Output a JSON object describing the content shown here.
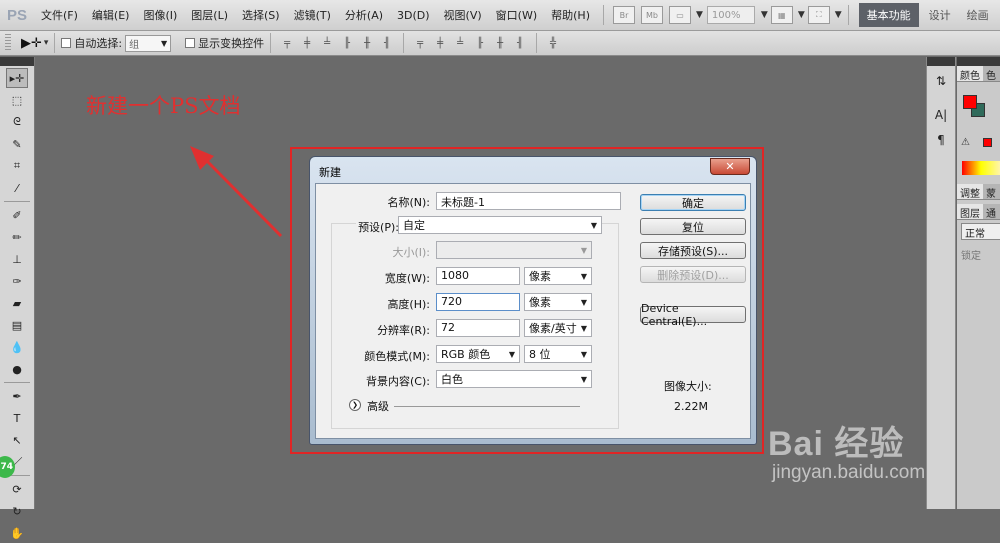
{
  "app": {
    "logo": "PS"
  },
  "menu": [
    "文件(F)",
    "编辑(E)",
    "图像(I)",
    "图层(L)",
    "选择(S)",
    "滤镜(T)",
    "分析(A)",
    "3D(D)",
    "视图(V)",
    "窗口(W)",
    "帮助(H)"
  ],
  "menubar": {
    "br_label": "Br",
    "mb_label": "Mb",
    "zoom": "100%",
    "workspaces": {
      "active": "基本功能",
      "design": "设计",
      "paint": "绘画"
    }
  },
  "options": {
    "auto_select_label": "自动选择:",
    "auto_select_target": "组",
    "show_transform_label": "显示变换控件"
  },
  "annotation": {
    "text": "新建一个PS文档",
    "color": "#e03030"
  },
  "dialog": {
    "title": "新建",
    "close_label": "✕",
    "name_label": "名称(N):",
    "name_value": "未标题-1",
    "preset_label": "预设(P):",
    "preset_value": "自定",
    "size_label": "大小(I):",
    "width_label": "宽度(W):",
    "width_value": "1080",
    "width_unit": "像素",
    "height_label": "高度(H):",
    "height_value": "720",
    "height_unit": "像素",
    "resolution_label": "分辨率(R):",
    "resolution_value": "72",
    "resolution_unit": "像素/英寸",
    "color_mode_label": "颜色模式(M):",
    "color_mode_value": "RGB 颜色",
    "bit_depth": "8 位",
    "bg_label": "背景内容(C):",
    "bg_value": "白色",
    "advanced_label": "高级",
    "buttons": {
      "ok": "确定",
      "reset": "复位",
      "save_preset": "存储预设(S)...",
      "delete_preset": "删除预设(D)...",
      "device_central": "Device Central(E)..."
    },
    "image_size_title": "图像大小:",
    "image_size_value": "2.22M"
  },
  "right_panel": {
    "color_tabs": [
      "颜色",
      "色"
    ],
    "adjust_tabs": [
      "调整",
      "蒙"
    ],
    "layers_tabs": [
      "图层",
      "通"
    ],
    "blend_mode": "正常",
    "lock_label": "锁定"
  },
  "badge": {
    "value": "74"
  },
  "watermark": {
    "logo": "Bai  经验",
    "url": "jingyan.baidu.com"
  },
  "colors": {
    "foreground": "#ff0000",
    "background": "#2f6a5a",
    "highlight": "#e02525"
  }
}
